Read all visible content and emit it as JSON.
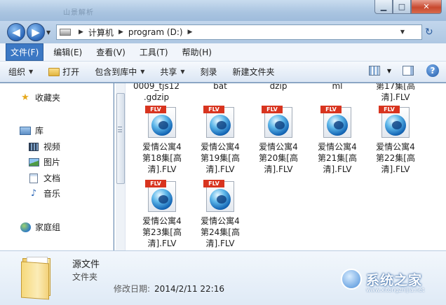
{
  "window": {
    "ghost_title": "山景解析"
  },
  "nav": {
    "back_glyph": "◀",
    "forward_glyph": "▶",
    "history_glyph": "▼",
    "refresh_glyph": "↻"
  },
  "address": {
    "breadcrumbs": [
      "计算机",
      "program (D:)"
    ],
    "separator": "▶",
    "dropdown_glyph": "▼"
  },
  "menu": [
    "文件(F)",
    "编辑(E)",
    "查看(V)",
    "工具(T)",
    "帮助(H)"
  ],
  "toolbar": {
    "organize": "组织",
    "open": "打开",
    "include_in_library": "包含到库中",
    "share": "共享",
    "burn": "刻录",
    "new_folder": "新建文件夹",
    "help_glyph": "?"
  },
  "navpane": {
    "favorites": "收藏夹",
    "libraries": "库",
    "videos": "视频",
    "pictures": "图片",
    "documents": "文档",
    "music": "音乐",
    "homegroup": "家庭组",
    "favorites_icon": "star-icon",
    "music_icon": "music-note-icon"
  },
  "partial_items": [
    "0009_tjs12\n.gdzip",
    "bat",
    "dzip",
    "ml",
    "第17集[高\n清].FLV"
  ],
  "files": [
    {
      "badge": "FLV",
      "name": "爱情公寓4\n第18集[高\n清].FLV"
    },
    {
      "badge": "FLV",
      "name": "爱情公寓4\n第19集[高\n清].FLV"
    },
    {
      "badge": "FLV",
      "name": "爱情公寓4\n第20集[高\n清].FLV"
    },
    {
      "badge": "FLV",
      "name": "爱情公寓4\n第21集[高\n清].FLV"
    },
    {
      "badge": "FLV",
      "name": "爱情公寓4\n第22集[高\n清].FLV"
    },
    {
      "badge": "FLV",
      "name": "爱情公寓4\n第23集[高\n清].FLV"
    },
    {
      "badge": "FLV",
      "name": "爱情公寓4\n第24集[高\n清].FLV"
    }
  ],
  "details": {
    "name": "源文件",
    "type": "文件夹",
    "date_label": "修改日期:",
    "date_value": "2014/2/11 22:16"
  },
  "watermark": {
    "text": "系统之家",
    "url": "www.xitongzhijia.net"
  },
  "colors": {
    "menu_active": "#3c78c4",
    "flv_badge": "#d8341f",
    "details_bg": "#e6eef8"
  }
}
